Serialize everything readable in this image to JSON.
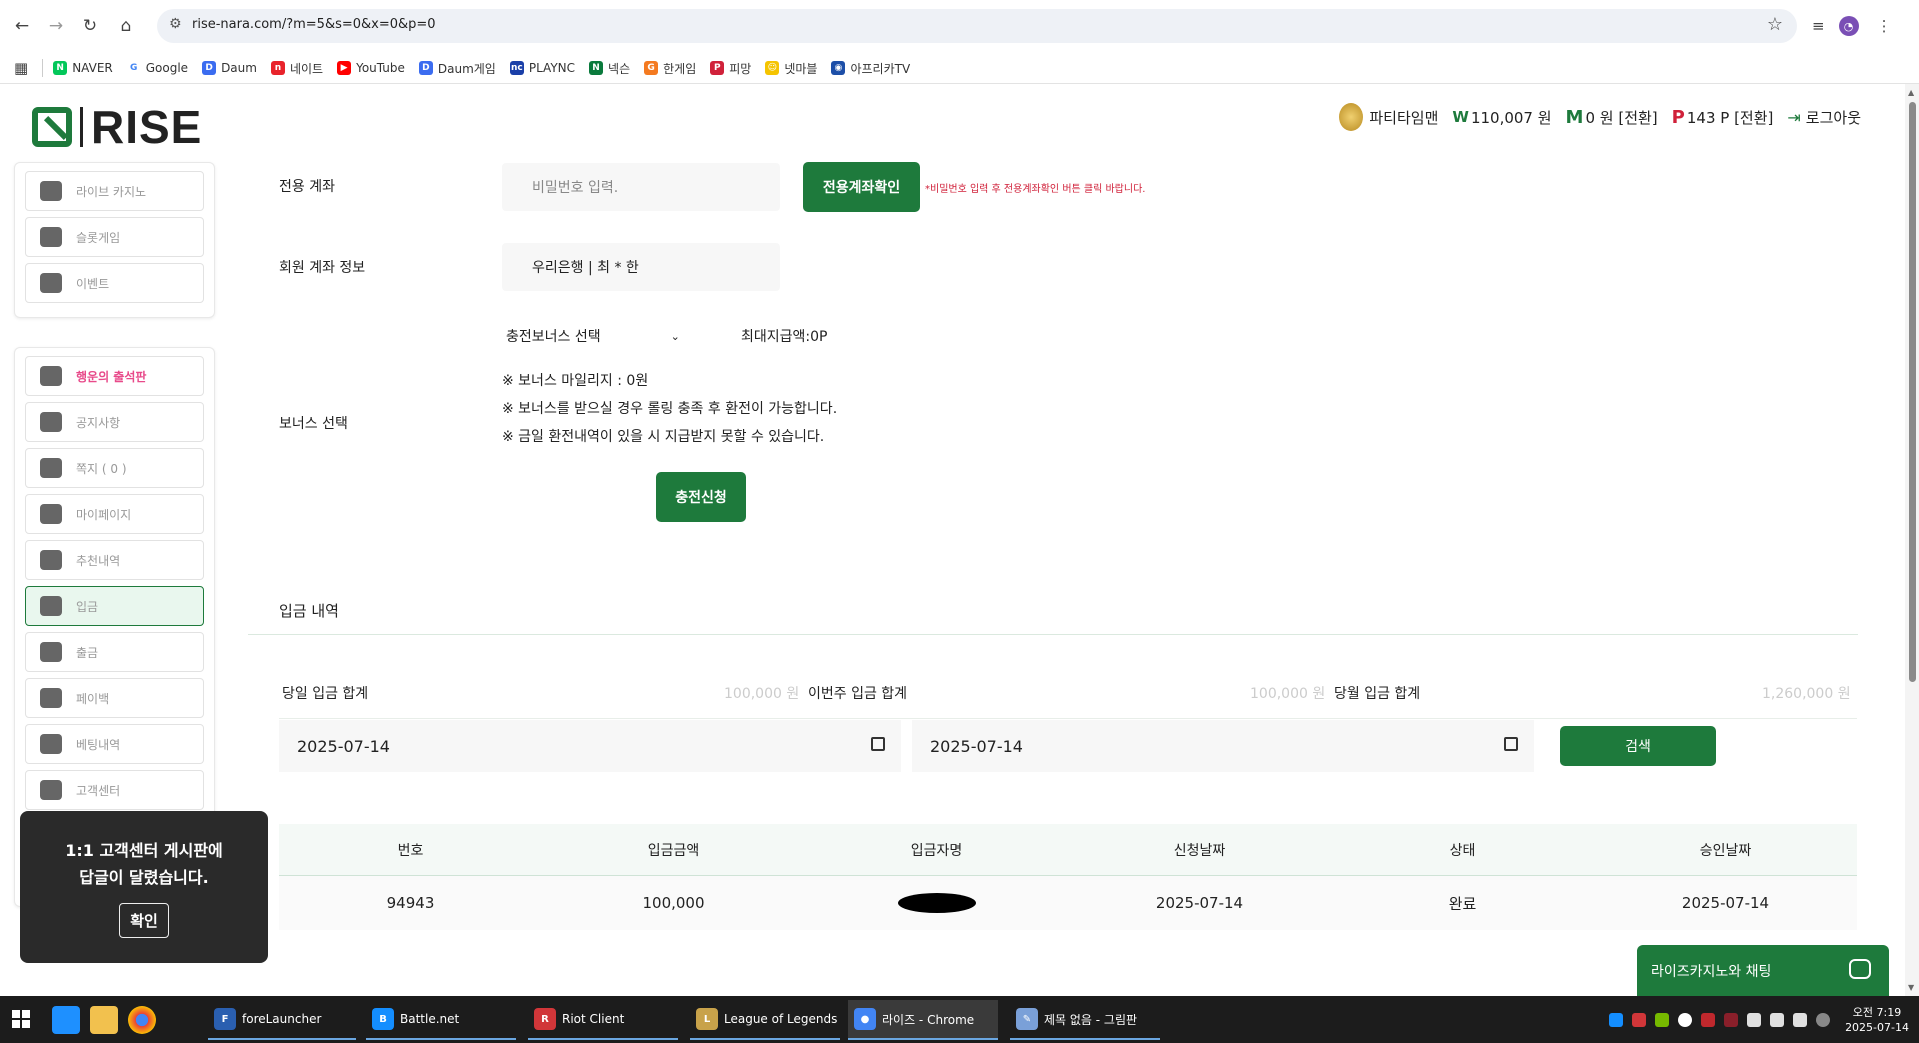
{
  "browser": {
    "url": "rise-nara.com/?m=5&s=0&x=0&p=0",
    "bookmarks": [
      {
        "label": "NAVER",
        "icon": "naver-icon",
        "color": "#03c75a",
        "glyph": "N"
      },
      {
        "label": "Google",
        "icon": "google-icon",
        "color": "#ffffff",
        "glyph": "G"
      },
      {
        "label": "Daum",
        "icon": "daum-icon",
        "color": "#3b6cf0",
        "glyph": "D"
      },
      {
        "label": "네이트",
        "icon": "nate-icon",
        "color": "#e8232b",
        "glyph": "n"
      },
      {
        "label": "YouTube",
        "icon": "youtube-icon",
        "color": "#ff0000",
        "glyph": "▶"
      },
      {
        "label": "Daum게임",
        "icon": "daum-game-icon",
        "color": "#3b6cf0",
        "glyph": "D"
      },
      {
        "label": "PLAYNC",
        "icon": "plaync-icon",
        "color": "#1a3fa8",
        "glyph": "nc"
      },
      {
        "label": "넥슨",
        "icon": "nexon-icon",
        "color": "#0a7a3c",
        "glyph": "N"
      },
      {
        "label": "한게임",
        "icon": "hangame-icon",
        "color": "#f47a20",
        "glyph": "G"
      },
      {
        "label": "피망",
        "icon": "pmang-icon",
        "color": "#d0213a",
        "glyph": "P"
      },
      {
        "label": "넷마블",
        "icon": "netmarble-icon",
        "color": "#f5c400",
        "glyph": "☺"
      },
      {
        "label": "아프리카TV",
        "icon": "afreecatv-icon",
        "color": "#1d4fa8",
        "glyph": "◉"
      }
    ]
  },
  "header": {
    "logo_text": "RISE",
    "username": "파티타임맨",
    "balance": "110,007 원",
    "balance_symbol": "W",
    "mileage_symbol": "M",
    "mileage": "0 원 [전환]",
    "point_symbol": "P",
    "points": "143 P [전환]",
    "logout": "로그아웃"
  },
  "sidebar": {
    "group1": [
      {
        "label": "라이브 카지노",
        "icon": "casino-chips-icon"
      },
      {
        "label": "슬롯게임",
        "icon": "slot-machine-icon"
      },
      {
        "label": "이벤트",
        "icon": "event-star-icon"
      }
    ],
    "group2": [
      {
        "label": "행운의 출석판",
        "icon": "calendar-icon",
        "highlight": true
      },
      {
        "label": "공지사항",
        "icon": "info-icon"
      },
      {
        "label": "쪽지 ( 0 )",
        "icon": "message-icon"
      },
      {
        "label": "마이페이지",
        "icon": "user-icon"
      },
      {
        "label": "추천내역",
        "icon": "heart-icon"
      },
      {
        "label": "입금",
        "icon": "wallet-in-icon",
        "active": true
      },
      {
        "label": "출금",
        "icon": "wallet-out-icon"
      },
      {
        "label": "페이백",
        "icon": "payback-icon"
      },
      {
        "label": "베팅내역",
        "icon": "bet-history-icon"
      },
      {
        "label": "고객센터",
        "icon": "support-icon"
      }
    ]
  },
  "deposit_form": {
    "account_label": "전용 계좌",
    "password_placeholder": "비밀번호 입력.",
    "confirm_button": "전용계좌확인",
    "confirm_note": "*비밀번호 입력 후 전용계좌확인 버튼 클릭 바랍니다.",
    "member_account_label": "회원 계좌 정보",
    "member_account_value": "우리은행 | 최 * 한",
    "bonus_label": "보너스 선택",
    "bonus_select": "충전보너스 선택",
    "max_payout": "최대지급액:0P",
    "info_lines": [
      "※ 보너스 마일리지 : 0원",
      "※ 보너스를 받으실 경우 롤링 충족 후 환전이 가능합니다.",
      "※ 금일 환전내역이 있을 시 지급받지 못할 수 있습니다."
    ],
    "submit_button": "충전신청"
  },
  "history": {
    "title": "입금 내역",
    "today_label": "당일 입금 합계",
    "today_value": "100,000 원",
    "week_label": "이번주 입금 합계",
    "week_value": "100,000 원",
    "month_label": "당월 입금 합계",
    "month_value": "1,260,000 원",
    "date_from": "2025-07-14",
    "date_to": "2025-07-14",
    "search_button": "검색",
    "columns": [
      "번호",
      "입금금액",
      "입금자명",
      "신청날짜",
      "상태",
      "승인날짜"
    ],
    "rows": [
      {
        "no": "94943",
        "amount": "100,000",
        "name_redacted": true,
        "requested": "2025-07-14",
        "status": "완료",
        "approved": "2025-07-14"
      }
    ]
  },
  "toast": {
    "line1": "1:1 고객센터 게시판에",
    "line2": "답글이 달렸습니다.",
    "ok": "확인"
  },
  "chat": {
    "label": "라이즈카지노와 채팅"
  },
  "taskbar": {
    "apps": [
      {
        "label": "foreLauncher",
        "icon": "forelauncher-icon",
        "color": "#2a5fb0",
        "glyph": "F"
      },
      {
        "label": "Battle.net",
        "icon": "battlenet-icon",
        "color": "#148eff",
        "glyph": "B"
      },
      {
        "label": "Riot Client",
        "icon": "riot-icon",
        "color": "#d13639",
        "glyph": "R"
      },
      {
        "label": "League of Legends",
        "icon": "lol-icon",
        "color": "#c8a24a",
        "glyph": "L"
      },
      {
        "label": "라이즈 - Chrome",
        "icon": "chrome-icon",
        "color": "#4285f4",
        "glyph": "●"
      },
      {
        "label": "제목 없음 - 그림판",
        "icon": "paint-icon",
        "color": "#7aa0d8",
        "glyph": "✎"
      }
    ],
    "time": "오전 7:19",
    "date": "2025-07-14"
  }
}
